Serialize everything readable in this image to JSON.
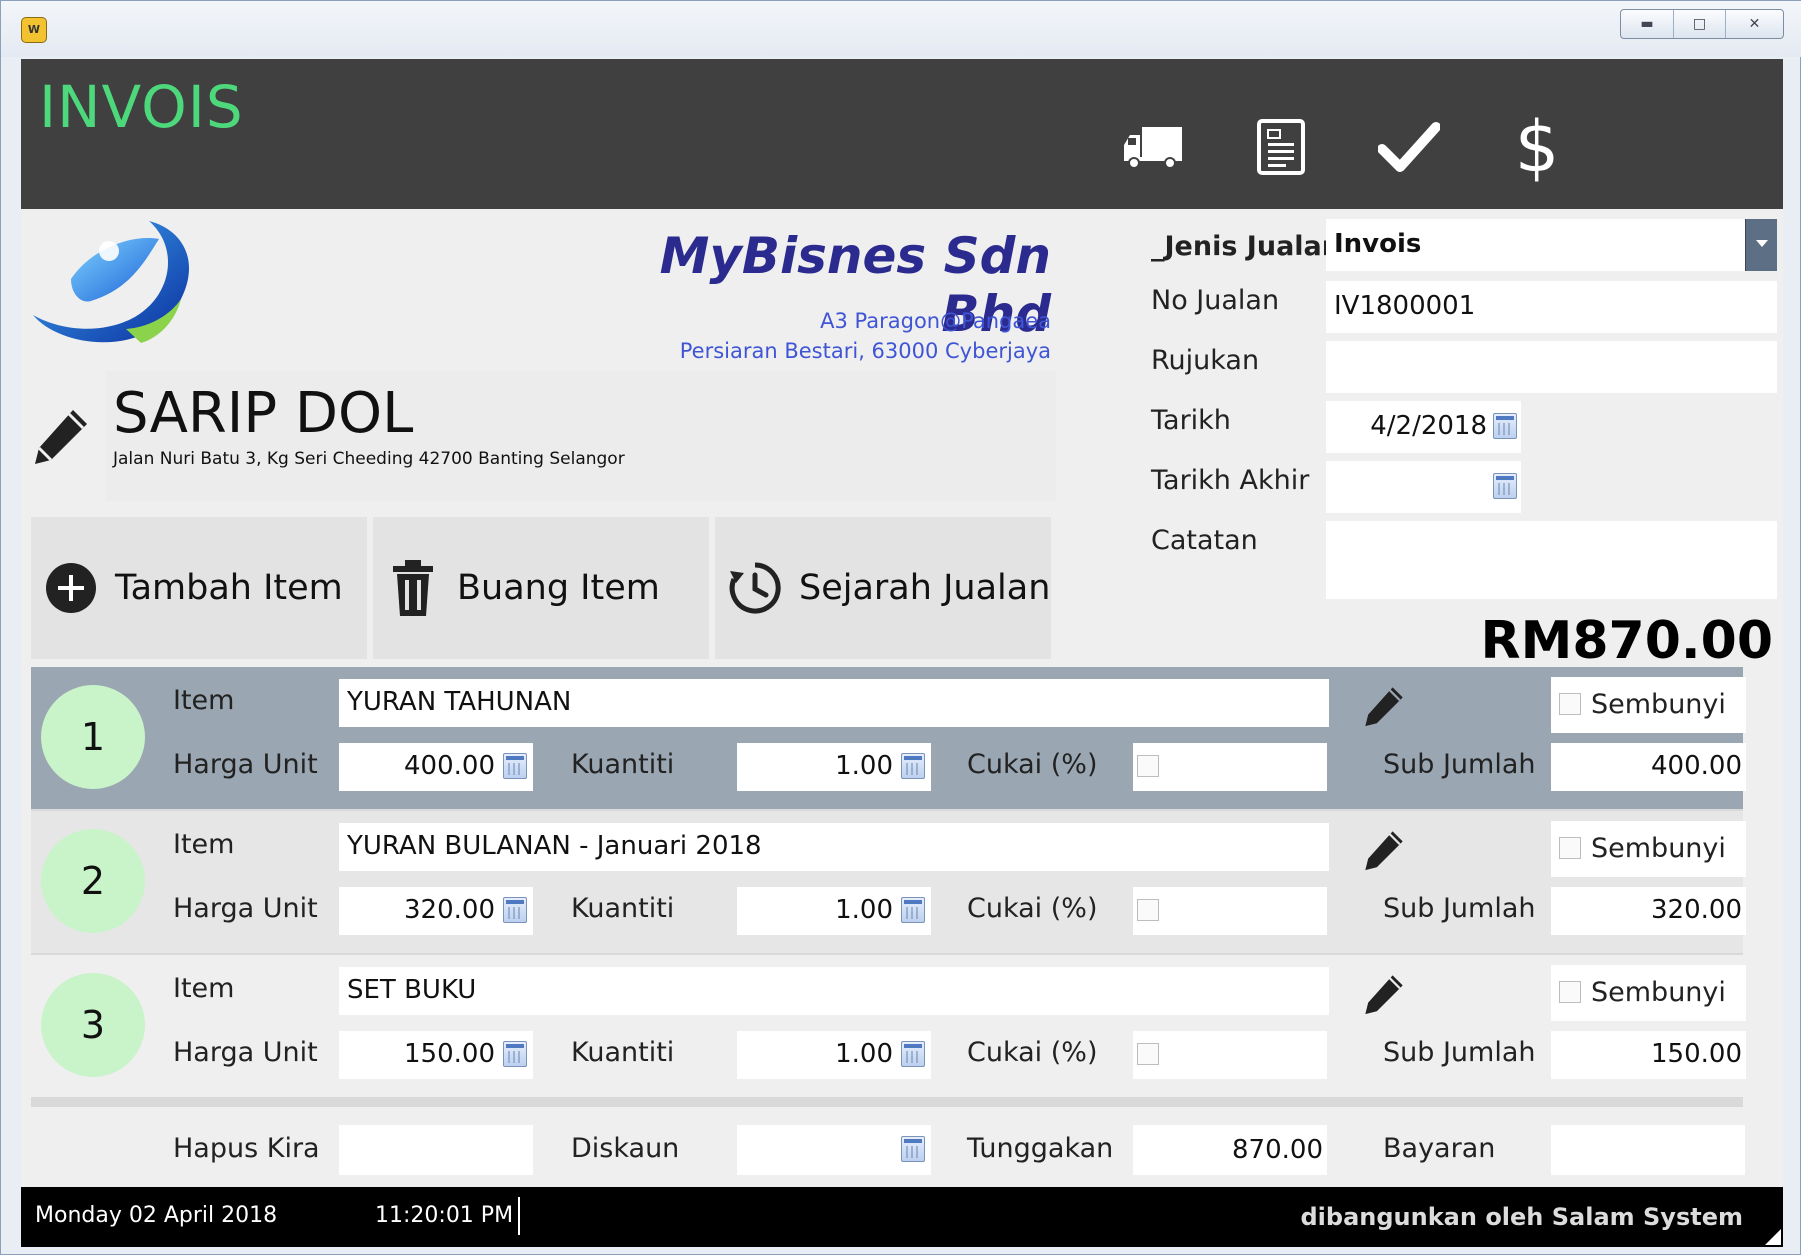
{
  "window": {
    "app_icon": "wo-app-icon",
    "controls": [
      "minimize",
      "maximize",
      "close"
    ]
  },
  "header": {
    "title": "INVOIS",
    "actions": [
      {
        "name": "delivery-truck-icon"
      },
      {
        "name": "document-icon"
      },
      {
        "name": "checkmark-icon"
      },
      {
        "name": "dollar-icon",
        "glyph": "$"
      }
    ]
  },
  "company": {
    "name": "MyBisnes Sdn Bhd",
    "address_line1": "A3 Paragon@Pangaea",
    "address_line2": "Persiaran Bestari, 63000 Cyberjaya"
  },
  "customer": {
    "name": "SARIP DOL",
    "address": "Jalan Nuri Batu 3, Kg Seri Cheeding 42700 Banting Selangor"
  },
  "actions": {
    "add_item": "Tambah Item",
    "remove_item": "Buang Item",
    "sales_history": "Sejarah Jualan"
  },
  "form": {
    "sale_type_label": "_Jenis Jualan",
    "sale_type_value": "Invois",
    "sale_no_label": "No Jualan",
    "sale_no_value": "IV1800001",
    "reference_label": "Rujukan",
    "reference_value": "",
    "date_label": "Tarikh",
    "date_value": "4/2/2018",
    "due_date_label": "Tarikh Akhir",
    "due_date_value": "",
    "notes_label": "Catatan",
    "notes_value": ""
  },
  "total": "RM870.00",
  "item_labels": {
    "item": "Item",
    "unit_price": "Harga Unit",
    "quantity": "Kuantiti",
    "tax": "Cukai (%)",
    "subtotal": "Sub Jumlah",
    "hide": "Sembunyi"
  },
  "items": [
    {
      "no": "1",
      "item": "YURAN TAHUNAN",
      "unit_price": "400.00",
      "quantity": "1.00",
      "subtotal": "400.00"
    },
    {
      "no": "2",
      "item": "YURAN BULANAN - Januari 2018",
      "unit_price": "320.00",
      "quantity": "1.00",
      "subtotal": "320.00"
    },
    {
      "no": "3",
      "item": "SET BUKU",
      "unit_price": "150.00",
      "quantity": "1.00",
      "subtotal": "150.00"
    }
  ],
  "footer": {
    "write_off_label": "Hapus Kira",
    "write_off_value": "",
    "discount_label": "Diskaun",
    "discount_value": "",
    "outstanding_label": "Tunggakan",
    "outstanding_value": "870.00",
    "payment_label": "Bayaran",
    "payment_value": ""
  },
  "status": {
    "date": "Monday 02 April 2018",
    "time": "11:20:01 PM",
    "credit": "dibangunkan oleh Salam System"
  },
  "colors": {
    "title_green": "#4dd87c",
    "header_bg": "#404040",
    "selected_row": "#9aa7b3",
    "number_circle": "#c9f3c8",
    "company_blue": "#2b2b8f"
  }
}
